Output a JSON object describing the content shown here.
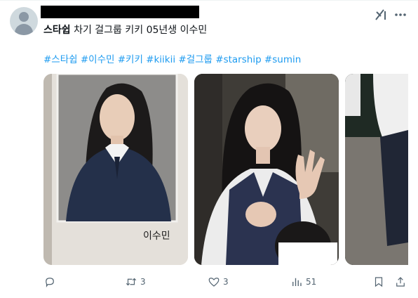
{
  "tweet": {
    "author_bold": "스타쉽",
    "text_rest": " 차기 걸그룹 키키 05년생 이수민",
    "hashtags": "#스타쉽 #이수민 #키키 #kiikii #걸그룹 #starship #sumin"
  },
  "media": {
    "photo1_caption": "이수민"
  },
  "actions": {
    "retweets": "3",
    "likes": "3",
    "views": "51"
  },
  "icons": {
    "reply": "reply-icon",
    "retweet": "retweet-icon",
    "like": "heart-icon",
    "views": "views-icon",
    "bookmark": "bookmark-icon",
    "share": "share-icon",
    "grok": "grok-icon",
    "more": "more-icon"
  },
  "colors": {
    "hashtag": "#1d9bf0",
    "muted": "#536471"
  }
}
